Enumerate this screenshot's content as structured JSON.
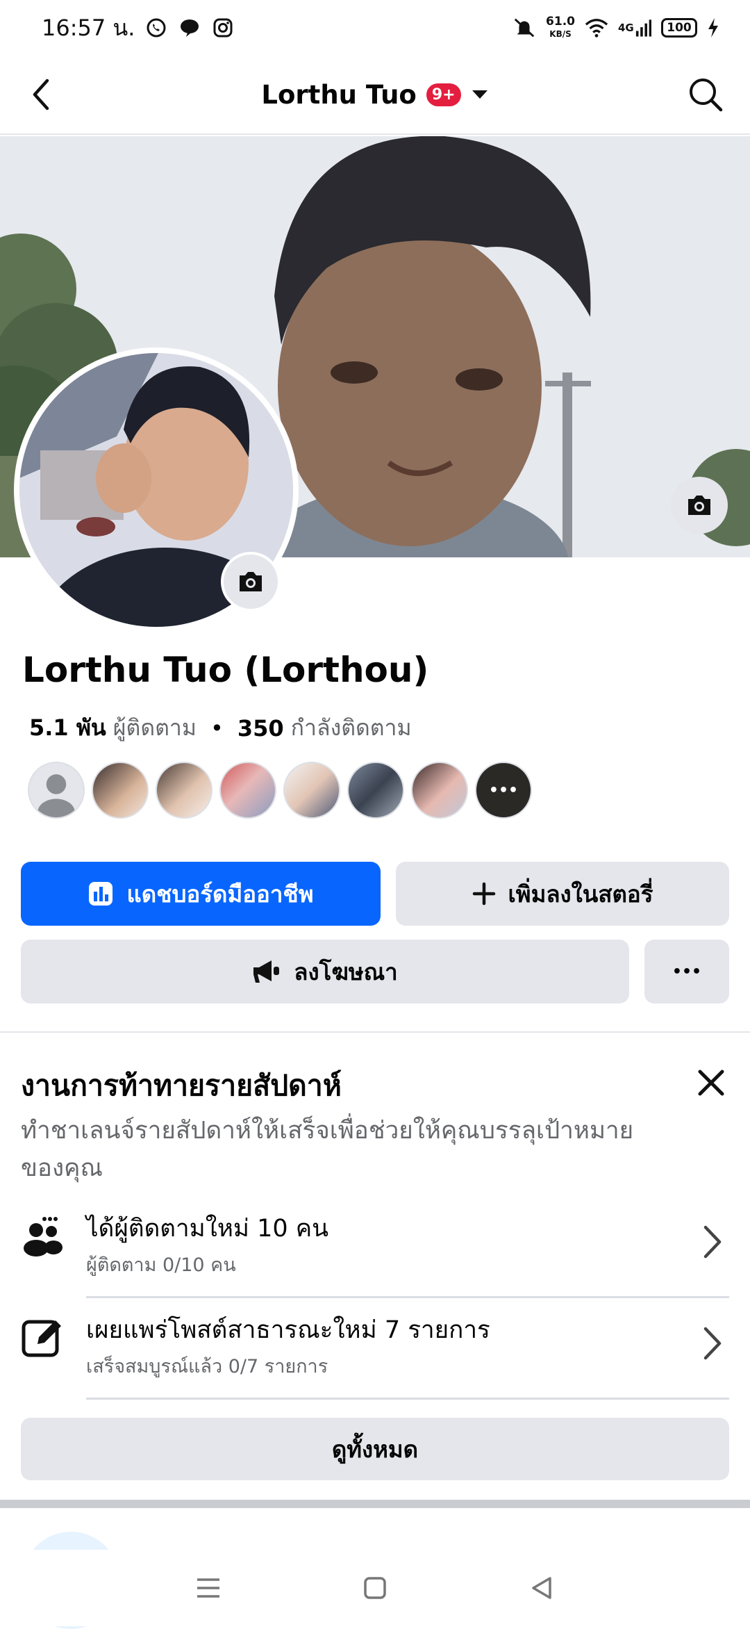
{
  "status_bar": {
    "time": "16:57 น.",
    "net_speed_value": "61.0",
    "net_speed_unit": "KB/S",
    "network": "4G",
    "battery": "100"
  },
  "top_bar": {
    "title": "Lorthu Tuo",
    "notification_badge": "9+"
  },
  "profile": {
    "name": "Lorthu Tuo (Lorthou)",
    "followers_count": "5.1 พัน",
    "followers_label": "ผู้ติดตาม",
    "separator": "•",
    "following_count": "350",
    "following_label": "กำลังติดตาม",
    "more_friends": "•••"
  },
  "actions": {
    "dashboard_label": "แดชบอร์ดมืออาชีพ",
    "add_story_label": "เพิ่มลงในสตอรี่",
    "advertise_label": "ลงโฆษณา",
    "more_label": "•••"
  },
  "challenge": {
    "title": "งานการท้าทายรายสัปดาห์",
    "description": "ทำชาเลนจ์รายสัปดาห์ให้เสร็จเพื่อช่วยให้คุณบรรลุเป้าหมายของคุณ",
    "tasks": [
      {
        "title": "ได้ผู้ติดตามใหม่ 10 คน",
        "subtitle": "ผู้ติดตาม 0/10 คน",
        "icon": "people-icon"
      },
      {
        "title": "เผยแพร่โพสต์สาธารณะใหม่ 7 รายการ",
        "subtitle": "เสร็จสมบูรณ์แล้ว 0/7 รายการ",
        "icon": "edit-icon"
      }
    ],
    "see_all_label": "ดูทั้งหมด"
  },
  "colors": {
    "primary": "#0866ff",
    "secondary_bg": "#e4e6eb",
    "badge": "#e41e3f"
  }
}
